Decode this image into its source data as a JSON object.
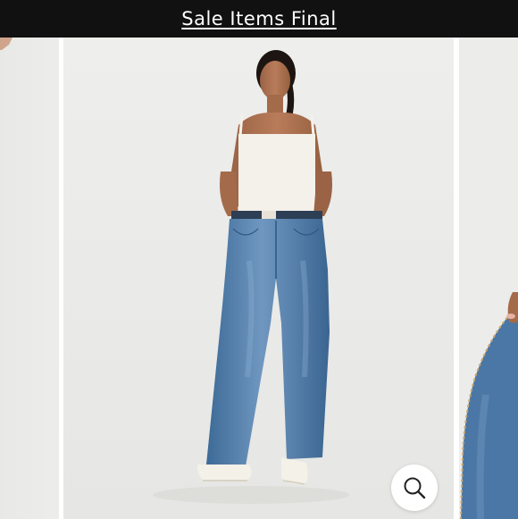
{
  "banner": {
    "text": "Sale Items Final"
  },
  "gallery": {
    "images": [
      {
        "name": "previous-product-image"
      },
      {
        "name": "model-wearing-flare-jeans"
      },
      {
        "name": "next-product-image-jeans-closeup"
      }
    ],
    "zoom_icon": "search-icon"
  },
  "colors": {
    "banner_bg": "#111111",
    "denim": "#4f7ba8",
    "background": "#ececea"
  }
}
